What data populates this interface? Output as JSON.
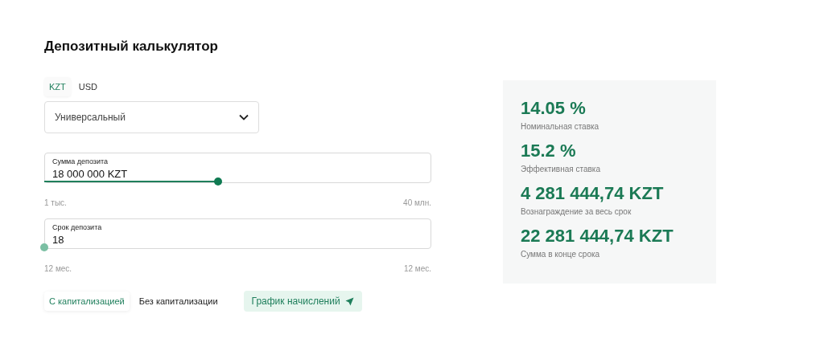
{
  "title": "Депозитный калькулятор",
  "currencies": [
    {
      "label": "KZT",
      "selected": true
    },
    {
      "label": "USD",
      "selected": false
    }
  ],
  "deposit_type": {
    "value": "Универсальный"
  },
  "sliders": [
    {
      "label": "Сумма депозита",
      "value": "18 000 000 KZT",
      "level": 0.45,
      "min": "1 тыс.",
      "max": "40 млн."
    },
    {
      "label": "Срок депозита",
      "value": "18",
      "level": 0,
      "min": "12 мес.",
      "max": "12 мес."
    }
  ],
  "capitalization": [
    {
      "label": "С капитализацией",
      "selected": true
    },
    {
      "label": "Без капитализации",
      "selected": false
    }
  ],
  "schedule_button": "График начислений",
  "results": [
    {
      "value": "14.05 %",
      "label": "Номинальная ставка"
    },
    {
      "value": "15.2 %",
      "label": "Эффективная ставка"
    },
    {
      "value": "4 281 444,74 KZT",
      "label": "Вознаграждение за весь срок"
    },
    {
      "value": "22 281 444,74 KZT",
      "label": "Сумма в конце срока"
    }
  ]
}
